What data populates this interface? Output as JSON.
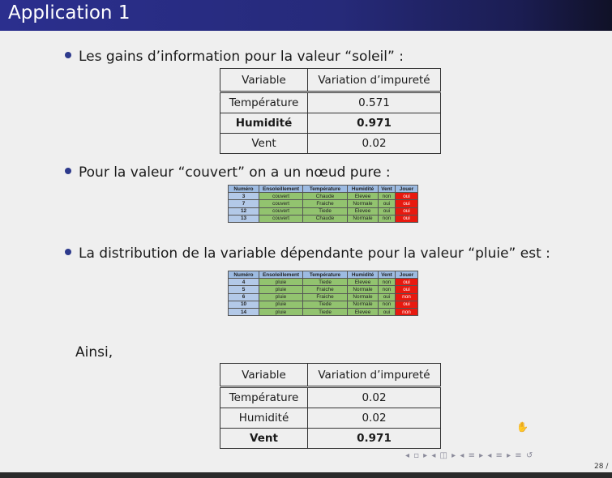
{
  "title": "Application 1",
  "bullets": {
    "b1": "Les gains d’information pour la valeur “soleil” :",
    "b2": "Pour la valeur “couvert” on a un nœud pure :",
    "b3": "La distribution de la variable dépendante pour la valeur “pluie” est :"
  },
  "ainsi": "Ainsi,",
  "table_soleil": {
    "headers": [
      "Variable",
      "Variation d’impureté"
    ],
    "rows": [
      {
        "variable": "Température",
        "value": "0.571"
      },
      {
        "variable": "Humidité",
        "value": "0.971"
      },
      {
        "variable": "Vent",
        "value": "0.02"
      }
    ]
  },
  "table_pluie_gain": {
    "headers": [
      "Variable",
      "Variation d’impureté"
    ],
    "rows": [
      {
        "variable": "Température",
        "value": "0.02"
      },
      {
        "variable": "Humidité",
        "value": "0.02"
      },
      {
        "variable": "Vent",
        "value": "0.971"
      }
    ]
  },
  "data_headers": [
    "Numéro",
    "Ensoleillement",
    "Température",
    "Humidité",
    "Vent",
    "Jouer"
  ],
  "table_couvert": [
    [
      "3",
      "couvert",
      "Chaude",
      "Elevee",
      "non",
      "oui"
    ],
    [
      "7",
      "couvert",
      "Fraiche",
      "Normale",
      "oui",
      "oui"
    ],
    [
      "12",
      "couvert",
      "Tiede",
      "Elevee",
      "oui",
      "oui"
    ],
    [
      "13",
      "couvert",
      "Chaude",
      "Normale",
      "non",
      "oui"
    ]
  ],
  "table_pluie": [
    [
      "4",
      "pluie",
      "Tiede",
      "Elevee",
      "non",
      "oui"
    ],
    [
      "5",
      "pluie",
      "Fraiche",
      "Normale",
      "non",
      "oui"
    ],
    [
      "6",
      "pluie",
      "Fraiche",
      "Normale",
      "oui",
      "non"
    ],
    [
      "10",
      "pluie",
      "Tiede",
      "Normale",
      "non",
      "oui"
    ],
    [
      "14",
      "pluie",
      "Tiede",
      "Elevee",
      "oui",
      "non"
    ]
  ],
  "nav_symbols": "◂ ▫ ▸ ◂ ◫ ▸ ◂ ≡ ▸ ◂ ≡ ▸ ≡ ↺",
  "page_number": "28 /"
}
